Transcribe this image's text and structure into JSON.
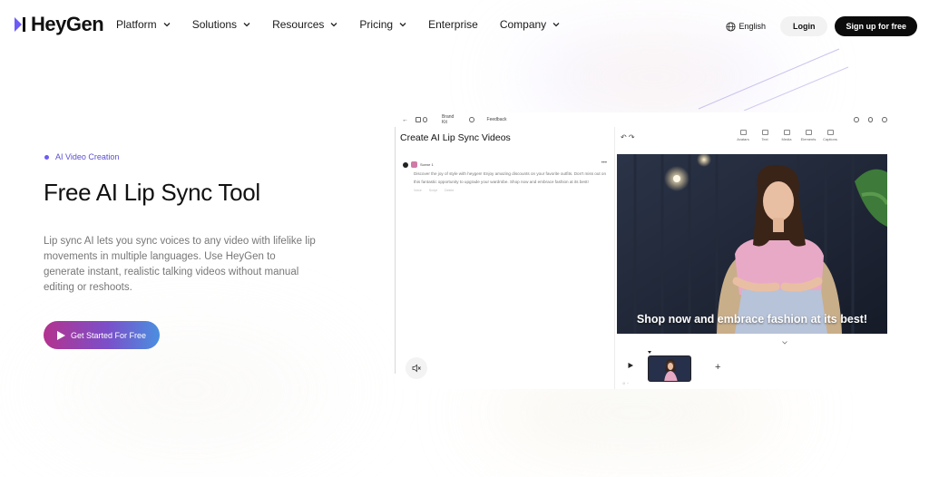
{
  "brand": {
    "name": "HeyGen"
  },
  "nav": {
    "items": [
      {
        "label": "Platform",
        "has_dropdown": true
      },
      {
        "label": "Solutions",
        "has_dropdown": true
      },
      {
        "label": "Resources",
        "has_dropdown": true
      },
      {
        "label": "Pricing",
        "has_dropdown": true
      },
      {
        "label": "Enterprise",
        "has_dropdown": false
      },
      {
        "label": "Company",
        "has_dropdown": true
      }
    ],
    "language": "English",
    "login": "Login",
    "signup": "Sign up for free"
  },
  "hero": {
    "tag": "AI Video Creation",
    "title": "Free AI Lip Sync Tool",
    "description": "Lip sync AI lets you sync voices to any video with lifelike lip movements in multiple languages. Use HeyGen to generate instant, realistic talking videos without manual editing or reshoots.",
    "cta": "Get Started For Free"
  },
  "app": {
    "top_bar": {
      "brand_kit": "Brand Kit",
      "feedback": "Feedback"
    },
    "panel_title": "Create AI Lip Sync Videos",
    "message": {
      "author": "Scene 1",
      "text": "Discover the joy of style with heygen! Enjoy amazing discounts on your favorite outfits. Don't miss out on this fantastic opportunity to upgrade your wardrobe. Shop now and embrace fashion at its best!",
      "actions": [
        "Voice",
        "Script",
        "Delete"
      ]
    },
    "tools": [
      "Avatars",
      "Text",
      "Media",
      "Elements",
      "Captions"
    ],
    "video_caption": "Shop now and embrace fashion at its best!"
  },
  "colors": {
    "accent_purple": "#6d5cf5",
    "cta_gradient": [
      "#b3338f",
      "#7b4fc9",
      "#4a8fe0"
    ],
    "dark": "#0b0b0b"
  }
}
